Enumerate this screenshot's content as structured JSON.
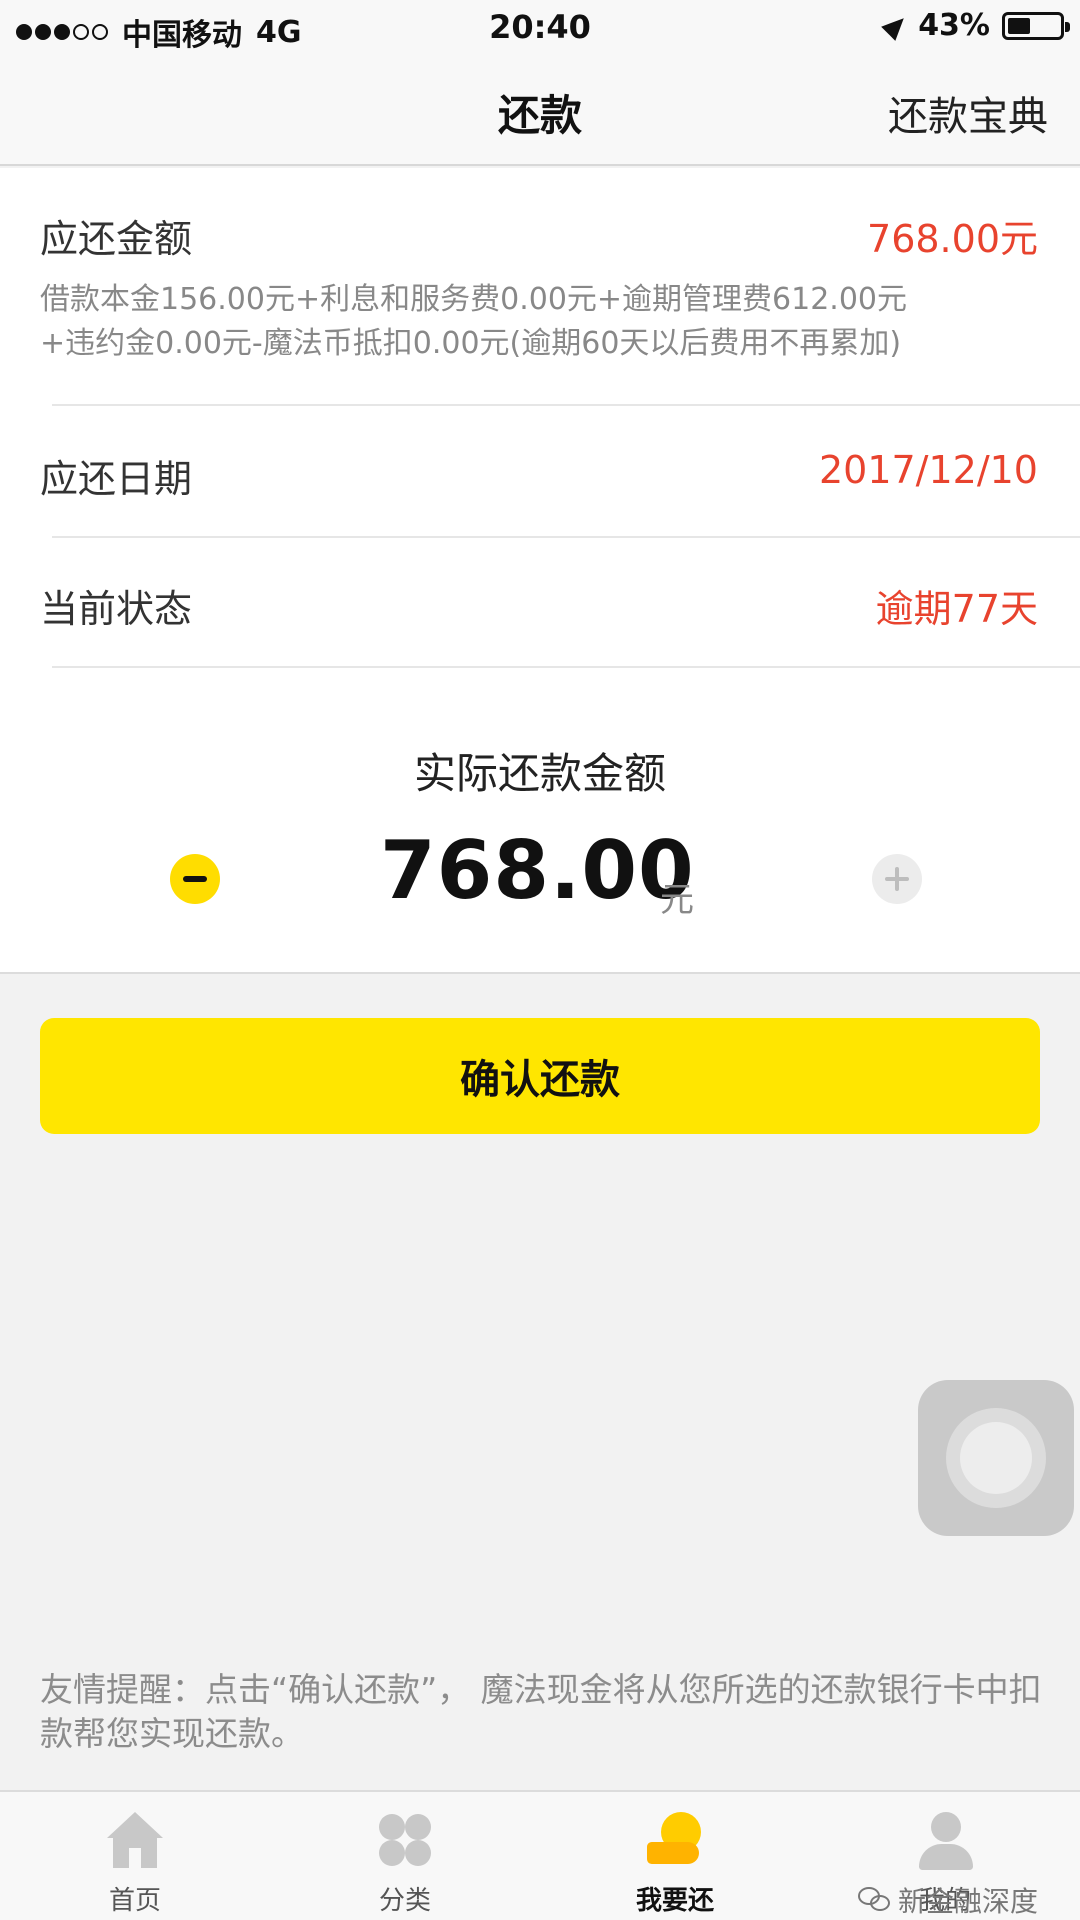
{
  "status_bar": {
    "carrier": "中国移动",
    "network": "4G",
    "time": "20:40",
    "battery_text": "43%",
    "battery_level": 0.43
  },
  "nav": {
    "title": "还款",
    "right_link": "还款宝典"
  },
  "repayment": {
    "amount_due_label": "应还金额",
    "amount_due_value": "768.00元",
    "breakdown_line1": "借款本金156.00元+利息和服务费0.00元+逾期管理费612.00元",
    "breakdown_line2": "+违约金0.00元-魔法币抵扣0.00元(逾期60天以后费用不再累加)",
    "due_date_label": "应还日期",
    "due_date_value": "2017/12/10",
    "status_label": "当前状态",
    "status_value": "逾期77天"
  },
  "actual_amount": {
    "title": "实际还款金额",
    "value": "768.00",
    "unit": "元"
  },
  "confirm_button": "确认还款",
  "tip": "友情提醒：点击“确认还款”， 魔法现金将从您所选的还款银行卡中扣款帮您实现还款。",
  "tabs": [
    {
      "label": "首页",
      "icon": "home-icon"
    },
    {
      "label": "分类",
      "icon": "category-icon"
    },
    {
      "label": "我要还",
      "icon": "repay-icon"
    },
    {
      "label": "我的",
      "icon": "user-icon"
    }
  ],
  "watermark": "新金融深度",
  "colors": {
    "accent_yellow": "#ffe600",
    "alert_red": "#e8432e"
  }
}
